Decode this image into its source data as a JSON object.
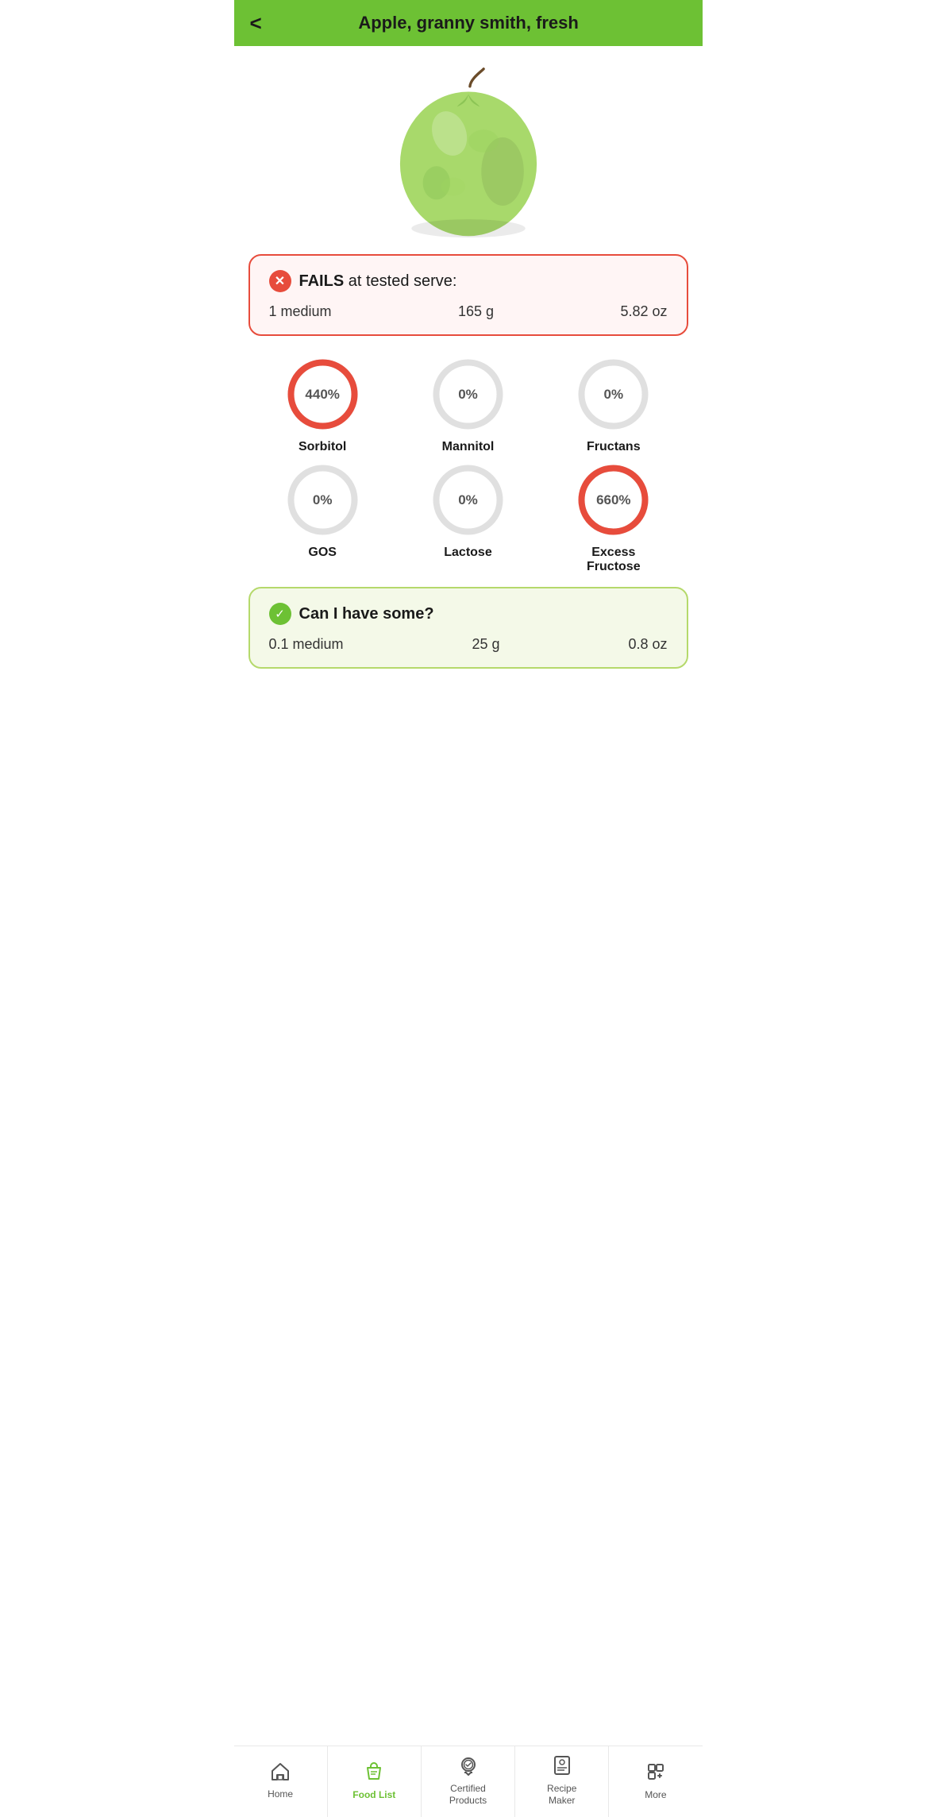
{
  "header": {
    "back_label": "<",
    "title": "Apple, granny smith, fresh"
  },
  "fails_card": {
    "icon": "✕",
    "heading_bold": "FAILS",
    "heading_rest": " at tested serve:",
    "serve_amount": "1 medium",
    "serve_grams": "165 g",
    "serve_oz": "5.82 oz"
  },
  "circles": [
    {
      "id": "sorbitol",
      "label": "Sorbitol",
      "value": "440%",
      "is_red": true
    },
    {
      "id": "mannitol",
      "label": "Mannitol",
      "value": "0%",
      "is_red": false
    },
    {
      "id": "fructans",
      "label": "Fructans",
      "value": "0%",
      "is_red": false
    },
    {
      "id": "gos",
      "label": "GOS",
      "value": "0%",
      "is_red": false
    },
    {
      "id": "lactose",
      "label": "Lactose",
      "value": "0%",
      "is_red": false
    },
    {
      "id": "excess-fructose",
      "label": "Excess\nFructose",
      "value": "660%",
      "is_red": true
    }
  ],
  "can_have_card": {
    "icon": "✓",
    "heading": "Can I have some?",
    "serve_amount": "0.1 medium",
    "serve_grams": "25 g",
    "serve_oz": "0.8 oz"
  },
  "nav": {
    "items": [
      {
        "id": "home",
        "label": "Home",
        "active": false
      },
      {
        "id": "food-list",
        "label": "Food List",
        "active": true
      },
      {
        "id": "certified-products",
        "label": "Certified\nProducts",
        "active": false
      },
      {
        "id": "recipe-maker",
        "label": "Recipe\nMaker",
        "active": false
      },
      {
        "id": "more",
        "label": "More",
        "active": false
      }
    ]
  }
}
